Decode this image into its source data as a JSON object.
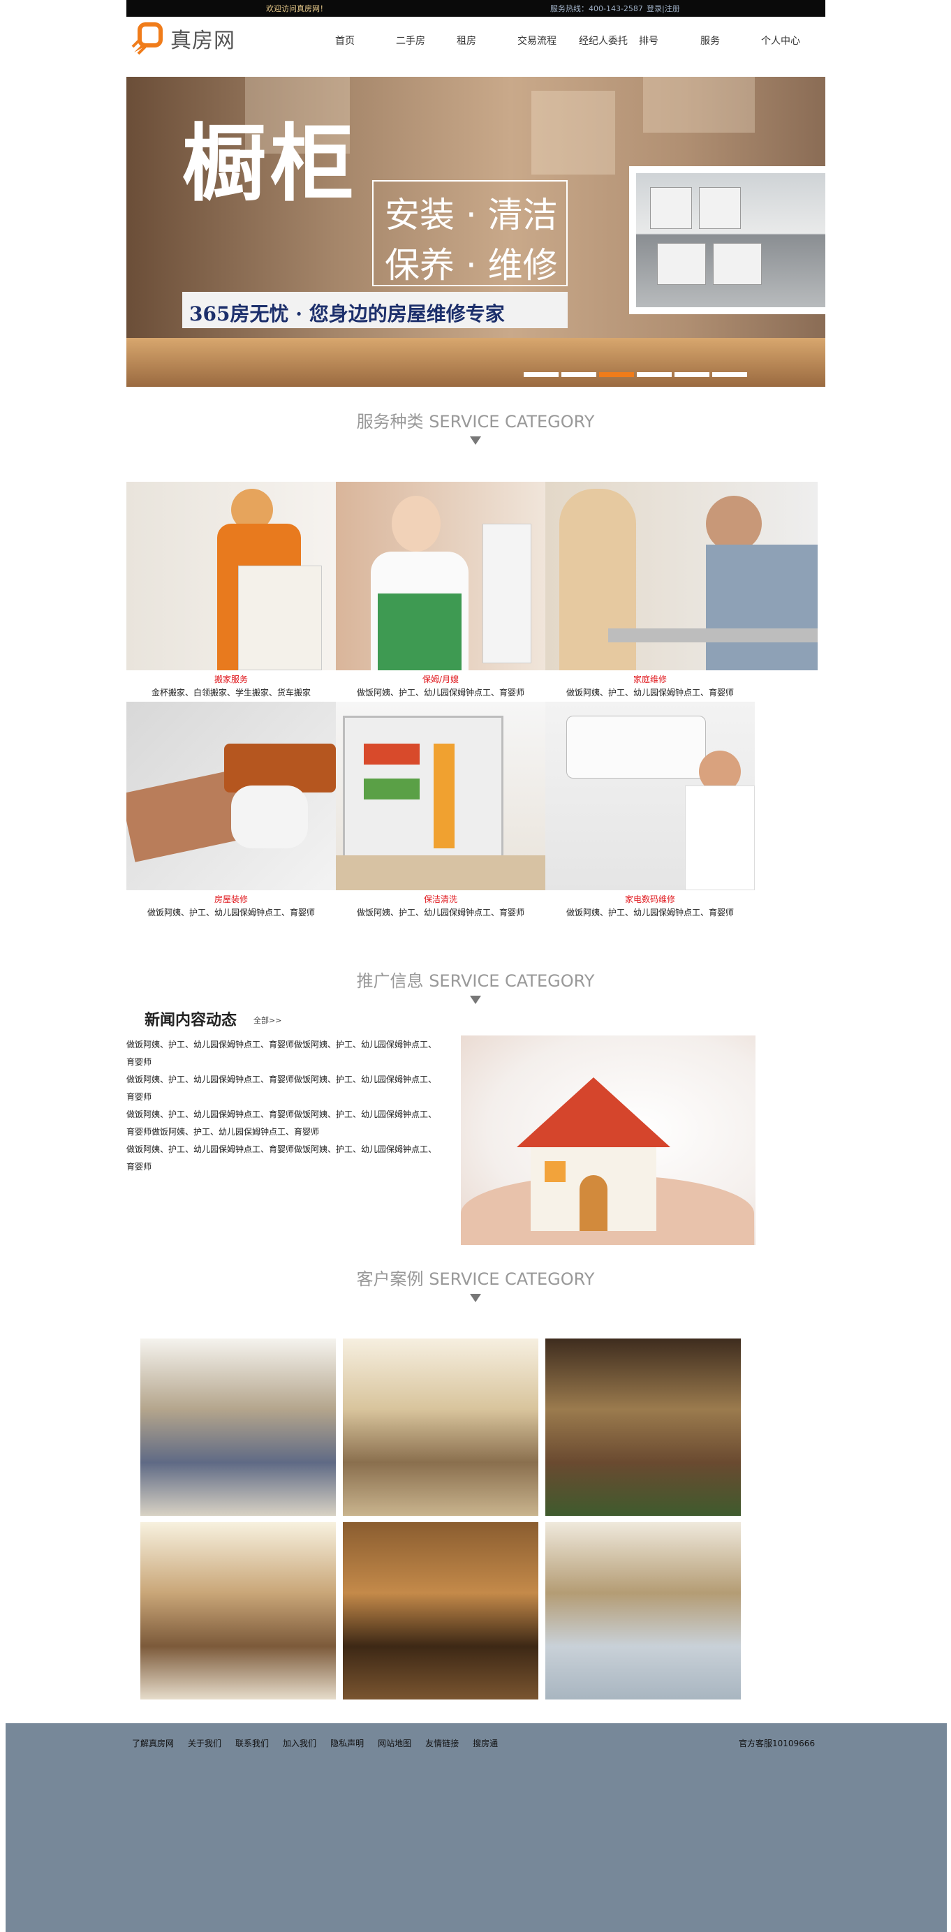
{
  "topbar": {
    "welcome": "欢迎访问真房网！",
    "hotline": "服务热线：400-143-2587",
    "login": "登录",
    "separator": "|",
    "register": "注册"
  },
  "header": {
    "brand": "真房网",
    "brand_color": "#f07c1a",
    "nav": [
      "首页",
      "二手房",
      "租房",
      "交易流程",
      "经纪人委托",
      "排号",
      "服务",
      "个人中心"
    ]
  },
  "banner": {
    "headline": "橱柜",
    "line1": "安装 · 清洁",
    "line2": "保养 · 维修",
    "tagline": "365房无忧 · 您身边的房屋维修专家",
    "slide_count": 6,
    "active_slide": 3,
    "accent": "#f07c1a"
  },
  "services": {
    "heading": "服务种类 SERVICE CATEGORY",
    "items": [
      {
        "name": "搬家服务",
        "desc": "金杯搬家、白领搬家、学生搬家、货车搬家"
      },
      {
        "name": "保姆/月嫂",
        "desc": "做饭阿姨、护工、幼儿园保姆钟点工、育婴师"
      },
      {
        "name": "家庭维修",
        "desc": "做饭阿姨、护工、幼儿园保姆钟点工、育婴师"
      },
      {
        "name": "房屋装修",
        "desc": "做饭阿姨、护工、幼儿园保姆钟点工、育婴师"
      },
      {
        "name": "保洁清洗",
        "desc": "做饭阿姨、护工、幼儿园保姆钟点工、育婴师"
      },
      {
        "name": "家电数码维修",
        "desc": "做饭阿姨、护工、幼儿园保姆钟点工、育婴师"
      }
    ]
  },
  "promo": {
    "heading": "推广信息 SERVICE CATEGORY",
    "news_title": "新闻内容动态",
    "more": "全部>>",
    "items": [
      "做饭阿姨、护工、幼儿园保姆钟点工、育婴师做饭阿姨、护工、幼儿园保姆钟点工、育婴师",
      "做饭阿姨、护工、幼儿园保姆钟点工、育婴师做饭阿姨、护工、幼儿园保姆钟点工、育婴师",
      "做饭阿姨、护工、幼儿园保姆钟点工、育婴师做饭阿姨、护工、幼儿园保姆钟点工、育婴师做饭阿姨、护工、幼儿园保姆钟点工、育婴师",
      "做饭阿姨、护工、幼儿园保姆钟点工、育婴师做饭阿姨、护工、幼儿园保姆钟点工、育婴师"
    ]
  },
  "cases": {
    "heading": "客户案例 SERVICE CATEGORY",
    "count": 6
  },
  "footer": {
    "links": [
      "了解真房网",
      "关于我们",
      "联系我们",
      "加入我们",
      "隐私声明",
      "网站地图",
      "友情链接",
      "搜房通"
    ],
    "service": "官方客服10109666",
    "background": "#778899"
  }
}
